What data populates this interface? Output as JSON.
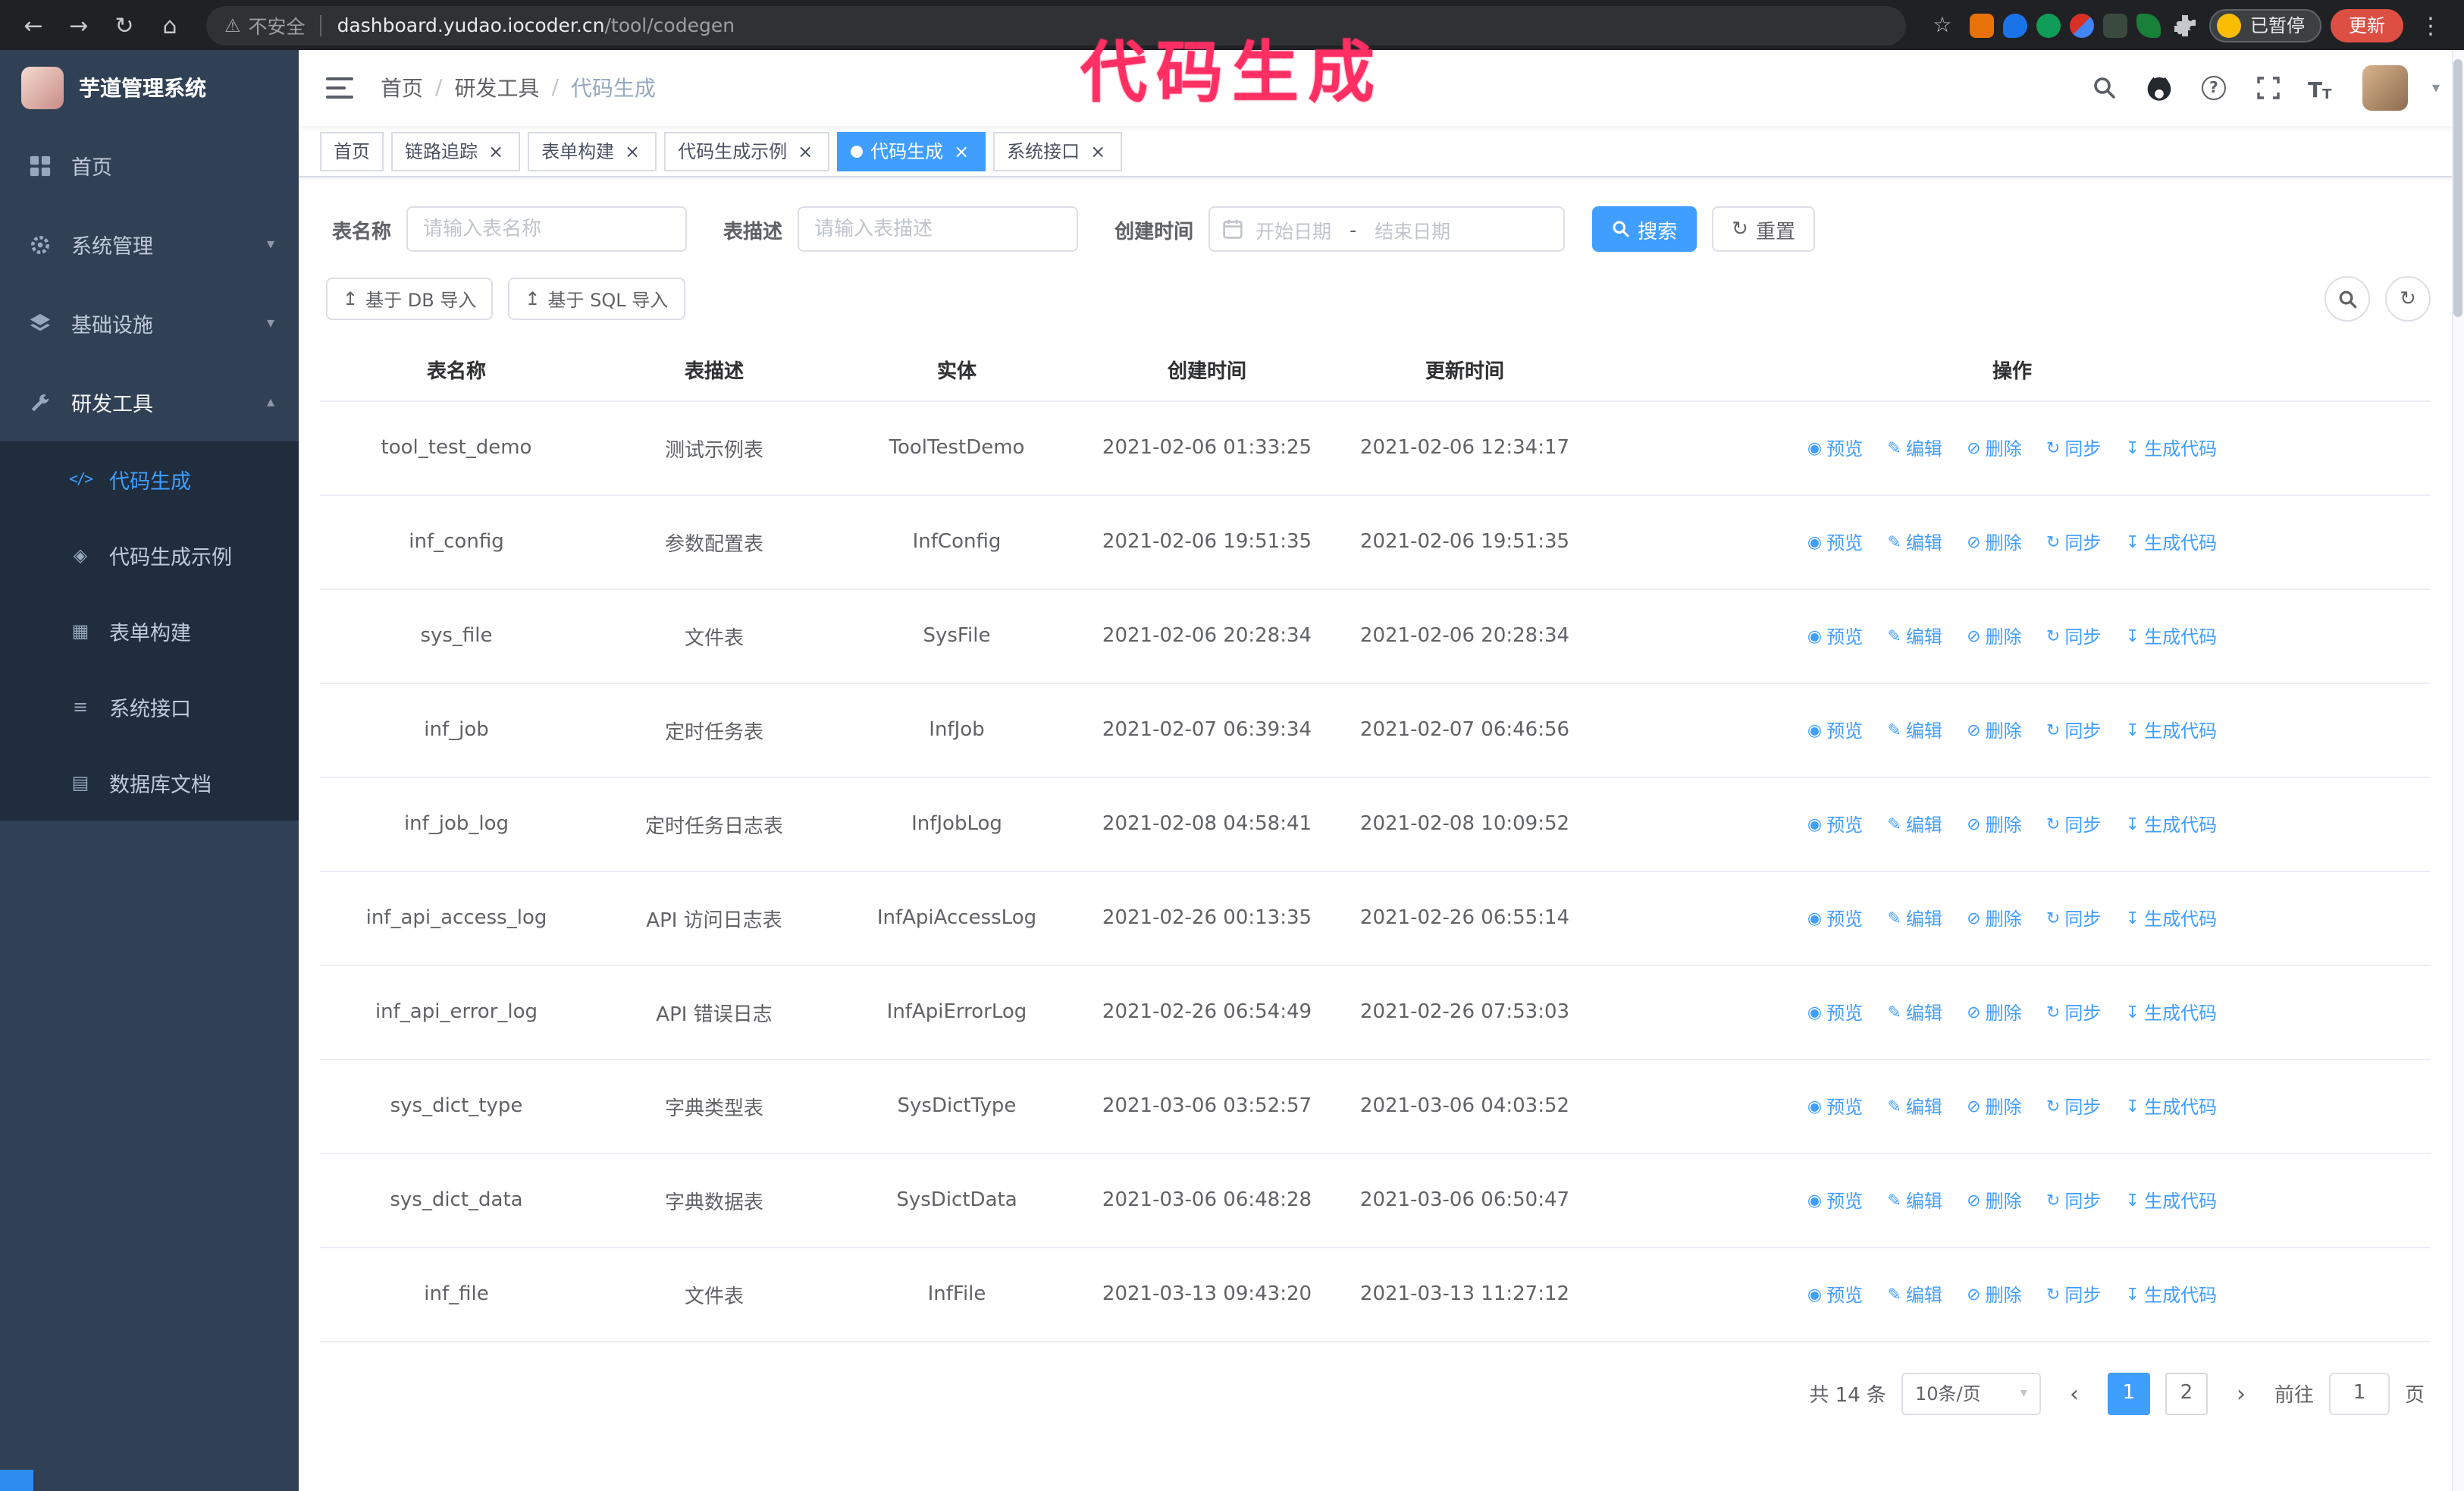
{
  "annotation": {
    "title": "代码生成",
    "color": "#ff2f64"
  },
  "colors": {
    "accent": "#409eff",
    "sidebar_bg": "#304156",
    "submenu_bg": "#1f2d3d",
    "update_button": "#dd4f43"
  },
  "icons": {
    "back": "←",
    "forward": "→",
    "reload": "↻",
    "home": "⌂",
    "star": "☆",
    "kebab": "⋮",
    "warning": "⚠",
    "close": "×",
    "chevron_down": "▾",
    "chevron_up": "▴",
    "caret_down": "▾",
    "refresh": "↻",
    "upload": "↥",
    "prev": "‹",
    "next": "›",
    "question": "?",
    "font_large": "T",
    "font_small": "T",
    "code": "</>",
    "example": "◈",
    "form": "▦",
    "api": "≡",
    "dbdoc": "▤"
  },
  "browser": {
    "security_label": "不安全",
    "url_host": "dashboard.yudao.iocoder.cn",
    "url_path": "/tool/codegen",
    "paused_badge": "已暂停",
    "update_button": "更新"
  },
  "sidebar": {
    "app_title": "芋道管理系统",
    "items": [
      {
        "label": "首页"
      },
      {
        "label": "系统管理"
      },
      {
        "label": "基础设施"
      },
      {
        "label": "研发工具"
      }
    ],
    "submenu": [
      {
        "label": "代码生成"
      },
      {
        "label": "代码生成示例"
      },
      {
        "label": "表单构建"
      },
      {
        "label": "系统接口"
      },
      {
        "label": "数据库文档"
      }
    ]
  },
  "header": {
    "breadcrumb": [
      "首页",
      "研发工具",
      "代码生成"
    ],
    "separator": "/"
  },
  "tabs": [
    {
      "label": "首页"
    },
    {
      "label": "链路追踪"
    },
    {
      "label": "表单构建"
    },
    {
      "label": "代码生成示例"
    },
    {
      "label": "代码生成"
    },
    {
      "label": "系统接口"
    }
  ],
  "filters": {
    "table_name_label": "表名称",
    "table_name_placeholder": "请输入表名称",
    "table_desc_label": "表描述",
    "table_desc_placeholder": "请输入表描述",
    "create_time_label": "创建时间",
    "start_date_placeholder": "开始日期",
    "date_separator": "-",
    "end_date_placeholder": "结束日期",
    "search_button": "搜索",
    "reset_button": "重置"
  },
  "toolbar": {
    "import_db_button": "基于 DB 导入",
    "import_sql_button": "基于 SQL 导入"
  },
  "table": {
    "columns": [
      "表名称",
      "表描述",
      "实体",
      "创建时间",
      "更新时间",
      "操作"
    ],
    "actions": [
      {
        "icon": "◉",
        "label": "预览"
      },
      {
        "icon": "✎",
        "label": "编辑"
      },
      {
        "icon": "⊘",
        "label": "删除"
      },
      {
        "icon": "↻",
        "label": "同步"
      },
      {
        "icon": "↧",
        "label": "生成代码"
      }
    ],
    "rows": [
      {
        "name": "tool_test_demo",
        "desc": "测试示例表",
        "entity": "ToolTestDemo",
        "created": "2021-02-06 01:33:25",
        "updated": "2021-02-06 12:34:17"
      },
      {
        "name": "inf_config",
        "desc": "参数配置表",
        "entity": "InfConfig",
        "created": "2021-02-06 19:51:35",
        "updated": "2021-02-06 19:51:35"
      },
      {
        "name": "sys_file",
        "desc": "文件表",
        "entity": "SysFile",
        "created": "2021-02-06 20:28:34",
        "updated": "2021-02-06 20:28:34"
      },
      {
        "name": "inf_job",
        "desc": "定时任务表",
        "entity": "InfJob",
        "created": "2021-02-07 06:39:34",
        "updated": "2021-02-07 06:46:56"
      },
      {
        "name": "inf_job_log",
        "desc": "定时任务日志表",
        "entity": "InfJobLog",
        "created": "2021-02-08 04:58:41",
        "updated": "2021-02-08 10:09:52"
      },
      {
        "name": "inf_api_access_log",
        "desc": "API 访问日志表",
        "entity": "InfApiAccessLog",
        "created": "2021-02-26 00:13:35",
        "updated": "2021-02-26 06:55:14"
      },
      {
        "name": "inf_api_error_log",
        "desc": "API 错误日志",
        "entity": "InfApiErrorLog",
        "created": "2021-02-26 06:54:49",
        "updated": "2021-02-26 07:53:03"
      },
      {
        "name": "sys_dict_type",
        "desc": "字典类型表",
        "entity": "SysDictType",
        "created": "2021-03-06 03:52:57",
        "updated": "2021-03-06 04:03:52"
      },
      {
        "name": "sys_dict_data",
        "desc": "字典数据表",
        "entity": "SysDictData",
        "created": "2021-03-06 06:48:28",
        "updated": "2021-03-06 06:50:47"
      },
      {
        "name": "inf_file",
        "desc": "文件表",
        "entity": "InfFile",
        "created": "2021-03-13 09:43:20",
        "updated": "2021-03-13 11:27:12"
      }
    ]
  },
  "pagination": {
    "total": "共 14 条",
    "page_size": "10条/页",
    "pages": [
      "1",
      "2"
    ],
    "active_page": "1",
    "goto_label": "前往",
    "goto_value": "1",
    "goto_suffix": "页"
  }
}
